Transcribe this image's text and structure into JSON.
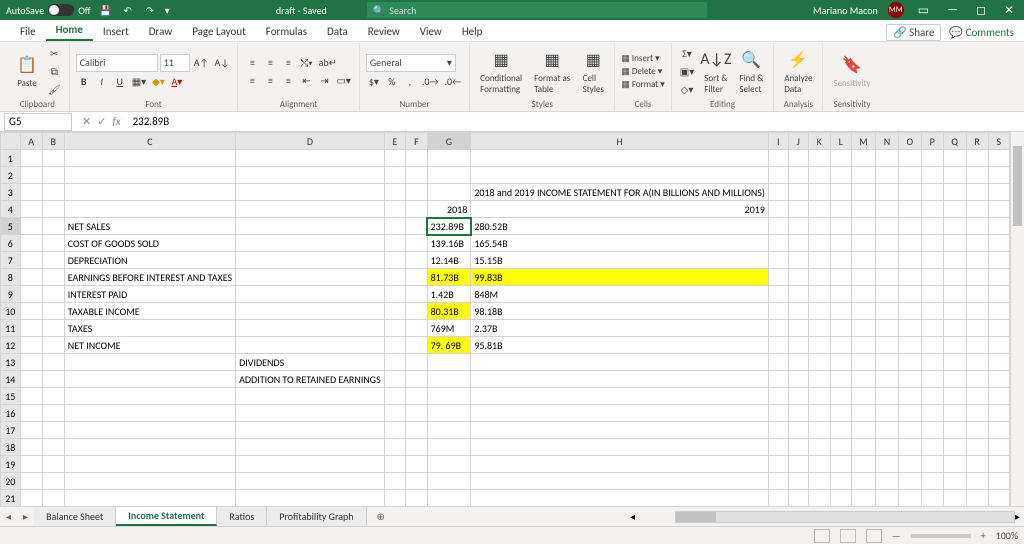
{
  "titlebar": {
    "autosave": "AutoSave",
    "autosave_state": "Off",
    "doc": "draft - Saved",
    "search_placeholder": "Search",
    "user": "Mariano Macon",
    "user_initials": "MM"
  },
  "menu": {
    "file": "File",
    "home": "Home",
    "insert": "Insert",
    "draw": "Draw",
    "page_layout": "Page Layout",
    "formulas": "Formulas",
    "data": "Data",
    "review": "Review",
    "view": "View",
    "help": "Help",
    "share": "Share",
    "comments": "Comments"
  },
  "ribbon": {
    "clipboard": "Clipboard",
    "paste": "Paste",
    "font": "Font",
    "font_name": "Calibri",
    "font_size": "11",
    "alignment": "Alignment",
    "number": "Number",
    "number_format": "General",
    "styles": "Styles",
    "cond_fmt": "Conditional\nFormatting",
    "fmt_table": "Format as\nTable",
    "cell_styles": "Cell\nStyles",
    "cells": "Cells",
    "insert_btn": "Insert",
    "delete_btn": "Delete",
    "format_btn": "Format",
    "editing": "Editing",
    "sort_filter": "Sort &\nFilter",
    "find_select": "Find &\nSelect",
    "analysis": "Analysis",
    "analyze": "Analyze\nData",
    "sensitivity": "Sensitivity",
    "sensitivity_btn": "Sensitivity"
  },
  "namebox": "G5",
  "fx_value": "232.89B",
  "columns": [
    "A",
    "B",
    "C",
    "D",
    "E",
    "F",
    "G",
    "H",
    "I",
    "J",
    "K",
    "L",
    "M",
    "N",
    "O",
    "P",
    "Q",
    "R",
    "S"
  ],
  "cells": {
    "H3": "2018 and 2019 INCOME STATEMENT FOR A(IN BILLIONS AND MILLIONS)",
    "G4": "2018",
    "H4": "2019",
    "C5": "NET SALES",
    "G5": "232.89B",
    "H5": "280.52B",
    "C6": "COST OF GOODS SOLD",
    "G6": "139.16B",
    "H6": "165.54B",
    "C7": "DEPRECIATION",
    "G7": "12.14B",
    "H7": "15.15B",
    "C8": "EARNINGS BEFORE INTEREST AND TAXES",
    "G8": "81.73B",
    "H8": "99.83B",
    "C9": "INTEREST PAID",
    "G9": "1.42B",
    "H9": "848M",
    "C10": "TAXABLE INCOME",
    "G10": "80.31B",
    "H10": "98.18B",
    "C11": "TAXES",
    "G11": "769M",
    "H11": "2.37B",
    "C12": "NET INCOME",
    "G12": "79. 69B",
    "H12": "95.81B",
    "D13": "DIVIDENDS",
    "D14": "ADDITION TO RETAINED EARNINGS"
  },
  "highlights": [
    "G8",
    "H8",
    "G10",
    "G12"
  ],
  "active_cell": "G5",
  "row_count": 21,
  "sheets": {
    "tabs": [
      "Balance Sheet",
      "Income Statement",
      "Ratios",
      "Profitability Graph"
    ],
    "active": "Income Statement"
  },
  "status": {
    "zoom": "100%"
  }
}
